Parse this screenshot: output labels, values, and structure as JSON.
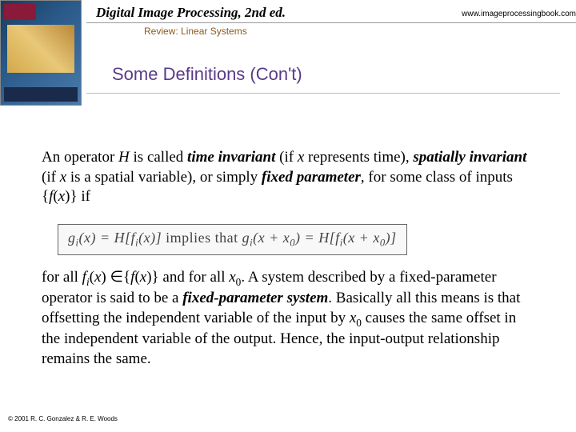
{
  "header": {
    "title": "Digital Image Processing, 2nd ed.",
    "url": "www.imageprocessingbook.com",
    "subtitle": "Review: Linear Systems"
  },
  "section_title": "Some Definitions (Con't)",
  "para1": {
    "t1": "An operator ",
    "H": "H",
    "t2": " is called ",
    "ti": "time invariant",
    "t3": " (if ",
    "x1": "x",
    "t4": " represents time), ",
    "si": "spatially invariant",
    "t5": " (if ",
    "x2": "x",
    "t6": " is a spatial variable), or simply ",
    "fp": "fixed parameter",
    "t7": ", for some class of inputs {",
    "fx": "f",
    "t8": "(",
    "x3": "x",
    "t9": ")} if"
  },
  "equation": {
    "lhs_g": "g",
    "lhs_i1": "i",
    "lhs_xp": "(x) = H[f",
    "lhs_i2": "i",
    "lhs_close": "(x)]",
    "mid": " implies that ",
    "rhs_g": "g",
    "rhs_i1": "i",
    "rhs_xx0": "(x + x",
    "rhs_0a": "0",
    "rhs_eq": ") = H[f",
    "rhs_i2": "i",
    "rhs_xx0b": "(x + x",
    "rhs_0b": "0",
    "rhs_close": ")]"
  },
  "para2": {
    "t1": "for all  ",
    "fi": "f",
    "sub_i": "i",
    "t2": "(",
    "x1": "x",
    "t3": ") ∈{",
    "f2": "f",
    "t4": "(",
    "x2": "x",
    "t5": ")} and for all ",
    "x0": "x",
    "sub0": "0",
    "t6": ".  A system described by a fixed-parameter operator is said to be a ",
    "fps": "fixed-parameter system",
    "t7": ".  Basically all this means is that offsetting the independent variable of the input by ",
    "x0b": "x",
    "sub0b": "0",
    "t8": " causes the same offset in the independent variable of the output.  Hence, the input-output relationship remains the same."
  },
  "copyright": "© 2001 R. C. Gonzalez & R. E. Woods"
}
